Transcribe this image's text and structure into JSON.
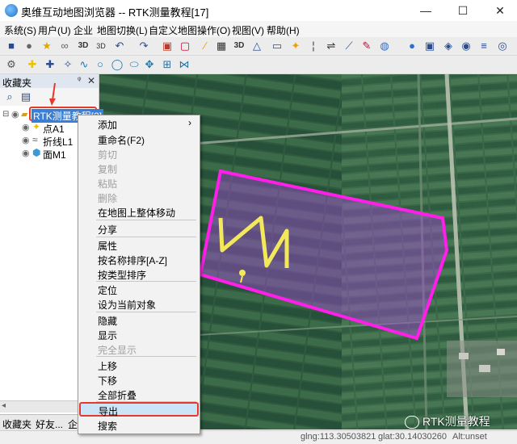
{
  "window": {
    "title": "奥维互动地图浏览器 -- RTK测量教程[17]",
    "min_glyph": "—",
    "max_glyph": "☐",
    "close_glyph": "✕"
  },
  "menubar": [
    {
      "label": "系统(S)"
    },
    {
      "label": "用户(U)"
    },
    {
      "label": "企业"
    },
    {
      "label": "地图切换(L)"
    },
    {
      "label": "自定义地图"
    },
    {
      "label": "操作(O)"
    },
    {
      "label": "视图(V)"
    },
    {
      "label": "帮助(H)"
    }
  ],
  "sidepanel": {
    "title": "收藏夹",
    "pin_glyph": "ᵠ",
    "close_glyph": "✕",
    "tree": {
      "root": "RTK测量教程[3]",
      "children": [
        "点A1",
        "折线L1",
        "面M1"
      ]
    },
    "tabs": [
      "收藏夹",
      "好友...",
      "企业"
    ]
  },
  "context_menu": {
    "items": [
      {
        "label": "添加",
        "submenu": true,
        "disabled": false
      },
      {
        "label": "重命名(F2)",
        "disabled": false
      },
      {
        "label": "剪切",
        "disabled": true
      },
      {
        "label": "复制",
        "disabled": true
      },
      {
        "label": "粘贴",
        "disabled": true
      },
      {
        "label": "删除",
        "disabled": true
      },
      {
        "label": "在地图上整体移动",
        "disabled": false
      },
      {
        "label": "分享",
        "disabled": false
      },
      {
        "label": "属性",
        "disabled": false
      },
      {
        "label": "按名称排序[A-Z]",
        "disabled": false
      },
      {
        "label": "按类型排序",
        "disabled": false
      },
      {
        "label": "定位",
        "disabled": false
      },
      {
        "label": "设为当前对象",
        "disabled": false
      },
      {
        "label": "隐藏",
        "disabled": false
      },
      {
        "label": "显示",
        "disabled": false
      },
      {
        "label": "完全显示",
        "disabled": true
      },
      {
        "label": "上移",
        "disabled": false
      },
      {
        "label": "下移",
        "disabled": false
      },
      {
        "label": "全部折叠",
        "disabled": false
      },
      {
        "label": "导出",
        "disabled": false,
        "highlighted": true
      },
      {
        "label": "搜索",
        "disabled": false
      }
    ],
    "submenu_glyph": "›"
  },
  "statusbar": {
    "lng": "glng:113.30503821",
    "lat": "glat:30.14030260",
    "alt": "Alt:unset"
  },
  "watermark": "RTK测量教程",
  "colors": {
    "polygon_stroke": "#ff1fe8",
    "polyline_stroke": "#f2e85a",
    "highlight_box": "#e53a2a",
    "selection_bg": "#3a7fd5",
    "menu_hover_bg": "#cce4f7"
  },
  "toolbar_icons": [
    "save-icon",
    "lock-icon",
    "star-icon",
    "binoculars-icon",
    "3d-icon",
    "3d-icon",
    "undo-icon",
    "redo-icon",
    "trash-icon",
    "select-icon",
    "pen-icon",
    "3d-icon",
    "layers-icon",
    "image-icon",
    "pin-icon",
    "split-icon",
    "measure-icon",
    "line-icon",
    "pen-icon",
    "globe-icon",
    "zoom-in-icon",
    "zoom-out-icon",
    "cube-icon",
    "info-icon",
    "filter-icon"
  ]
}
